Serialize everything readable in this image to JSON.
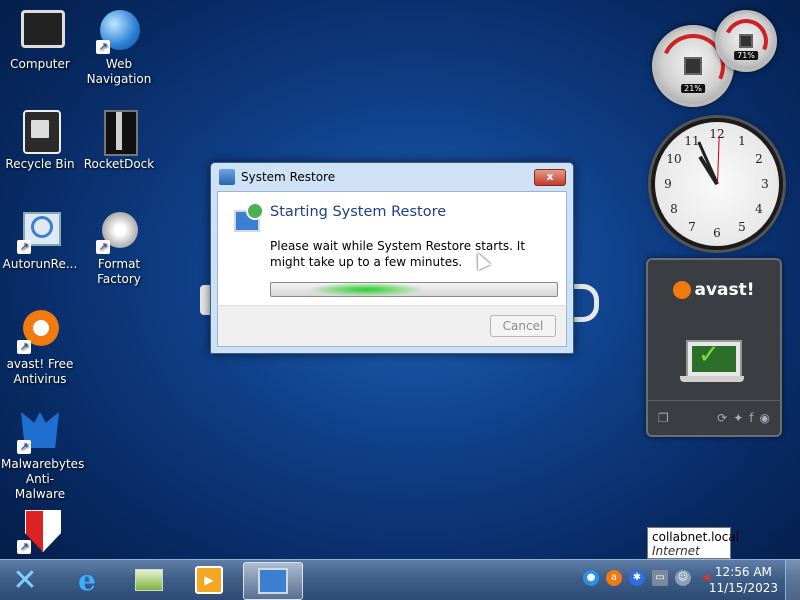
{
  "desktop": {
    "icons": [
      {
        "label": "Computer",
        "icon": "computer-icon"
      },
      {
        "label": "Web Navigation",
        "icon": "globe-icon"
      },
      {
        "label": "Recycle Bin",
        "icon": "recycle-bin-icon"
      },
      {
        "label": "RocketDock",
        "icon": "rocketdock-icon"
      },
      {
        "label": "AutorunRe...",
        "icon": "autorun-icon"
      },
      {
        "label": "Format Factory",
        "icon": "format-factory-icon"
      },
      {
        "label": "avast! Free Antivirus",
        "icon": "avast-icon"
      },
      {
        "label": "Malwarebytes Anti-Malware",
        "icon": "malwarebytes-icon"
      },
      {
        "label": "",
        "icon": "shield-icon"
      }
    ]
  },
  "gadgets": {
    "cpu_meter": {
      "cpu": "21%",
      "memory": "71%"
    },
    "clock": {
      "time": "11:56"
    },
    "avast": {
      "logo": "avast!",
      "status_icon": "check-icon"
    }
  },
  "dialog": {
    "title": "System Restore",
    "heading": "Starting System Restore",
    "message": "Please wait while System Restore starts. It might take up to a few minutes.",
    "cancel_label": "Cancel",
    "close_label": "x"
  },
  "tooltip": {
    "line1": "collabnet.local",
    "line2": "Internet access"
  },
  "taskbar": {
    "pinned": [
      "start-icon",
      "internet-explorer-icon",
      "file-explorer-icon",
      "media-player-icon",
      "system-restore-icon"
    ],
    "tray_icons": [
      "network-icon",
      "avast-tray-icon",
      "bluetooth-icon",
      "monitor-icon",
      "user-icon",
      "volume-icon"
    ],
    "time": "12:56 AM",
    "date": "11/15/2023"
  },
  "colors": {
    "accent": "#1e3f8a",
    "avast_orange": "#f07a10",
    "progress_green": "#2ccc2c"
  }
}
